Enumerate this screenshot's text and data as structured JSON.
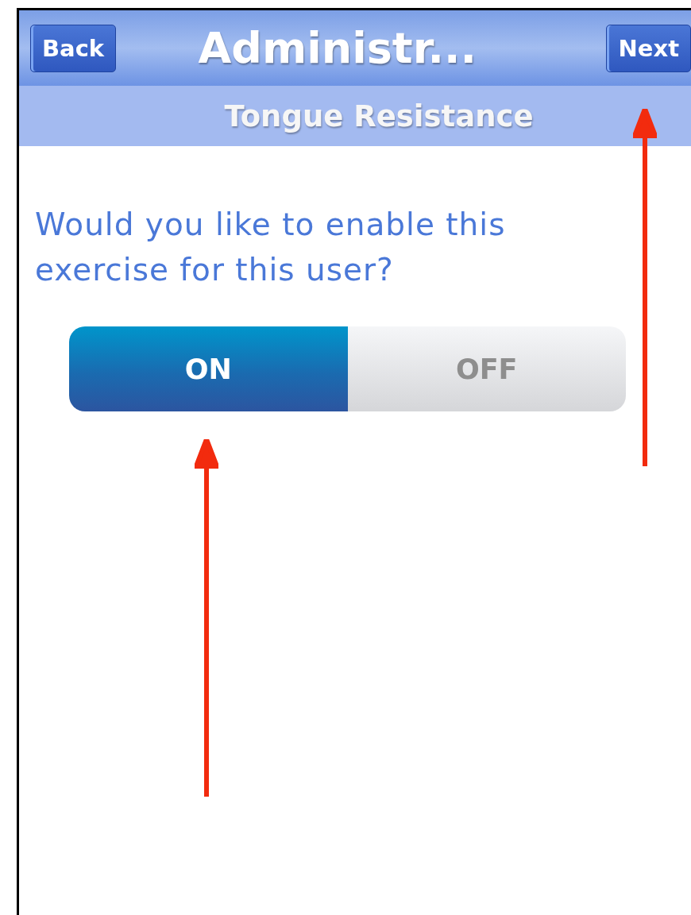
{
  "nav_bar": {
    "back_button": "Back",
    "title": "Administr...",
    "next_button": "Next"
  },
  "sub_header": {
    "title": "Tongue Resistance"
  },
  "question": "Would you like to enable this exercise for this user?",
  "toggle": {
    "options": [
      {
        "label": "ON",
        "selected": true
      },
      {
        "label": "OFF",
        "selected": false
      }
    ]
  }
}
